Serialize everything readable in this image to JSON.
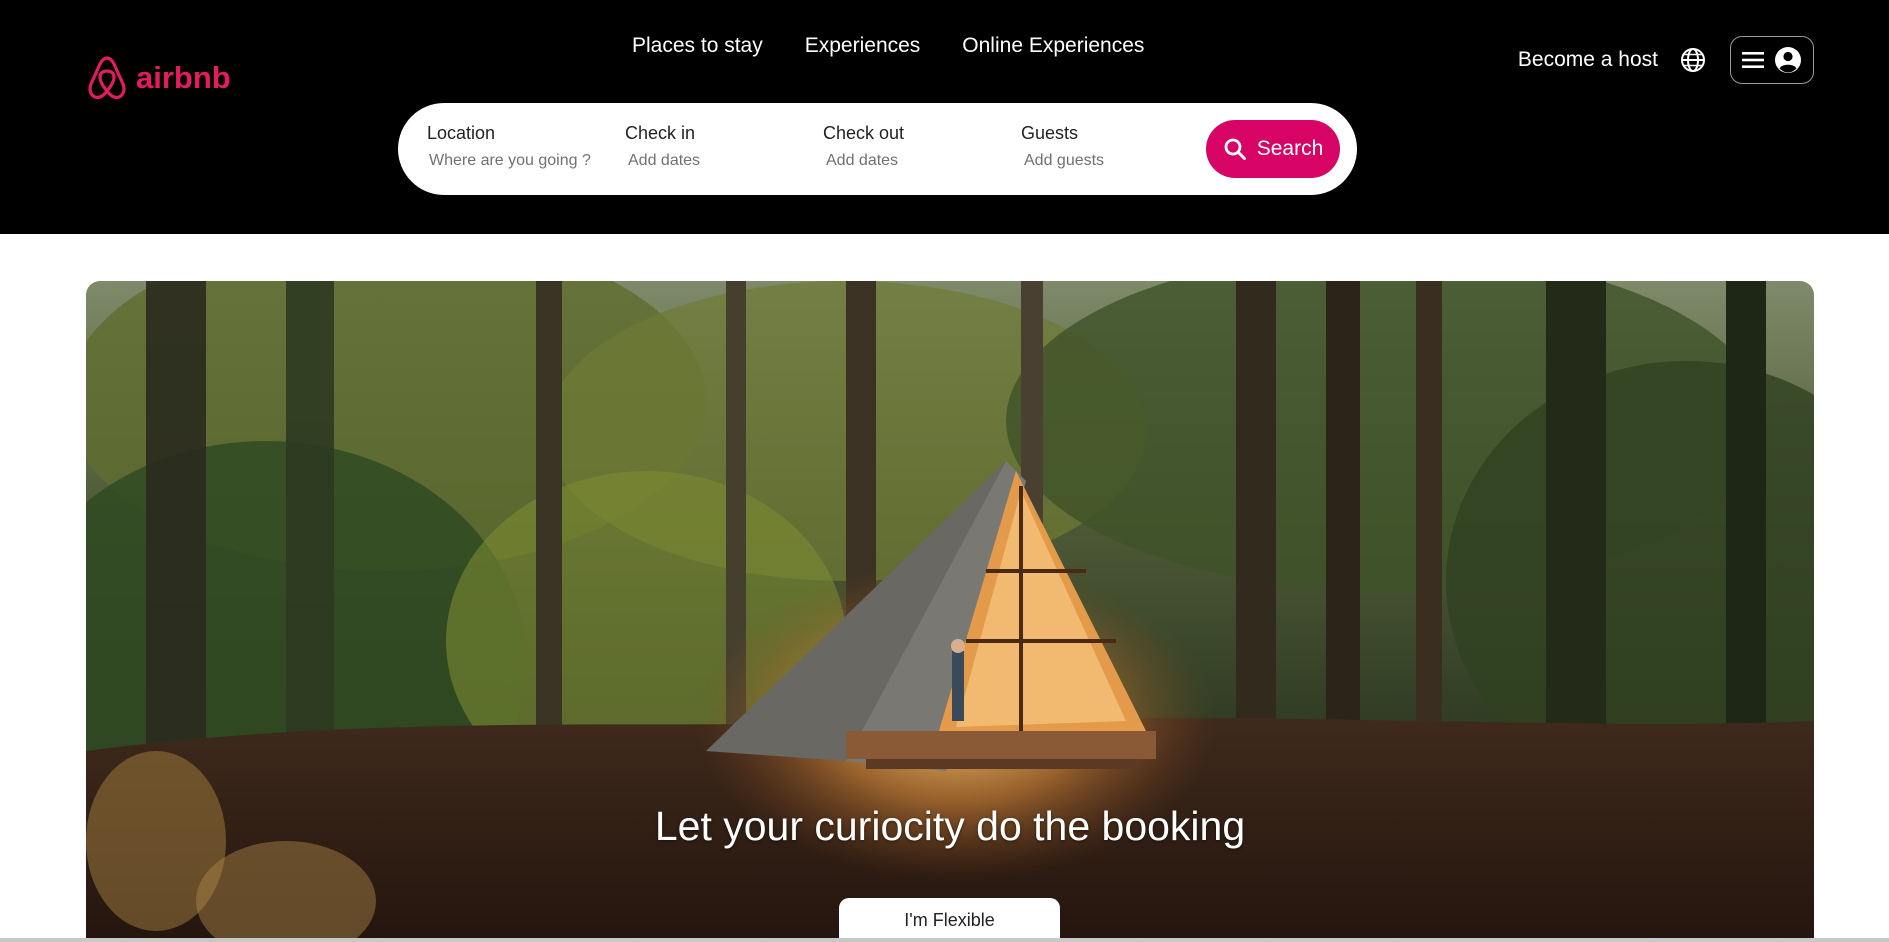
{
  "brand": {
    "name": "airbnb",
    "color": "#e31c5f",
    "logo_icon": "airbnb-belo-icon"
  },
  "header": {
    "nav": [
      "Places to stay",
      "Experiences",
      "Online Experiences"
    ],
    "become_host": "Become a host",
    "globe_icon": "globe-icon",
    "menu_icon": "hamburger-icon",
    "user_icon": "user-circle-icon"
  },
  "search": {
    "location": {
      "label": "Location",
      "placeholder": "Where are you going ?"
    },
    "checkin": {
      "label": "Check in",
      "placeholder": "Add dates"
    },
    "checkout": {
      "label": "Check out",
      "placeholder": "Add dates"
    },
    "guests": {
      "label": "Guests",
      "placeholder": "Add guests"
    },
    "button_label": "Search",
    "button_color": "#d70466",
    "button_icon": "search-icon"
  },
  "hero": {
    "title": "Let your curiocity do the booking",
    "cta": "I'm Flexible"
  }
}
